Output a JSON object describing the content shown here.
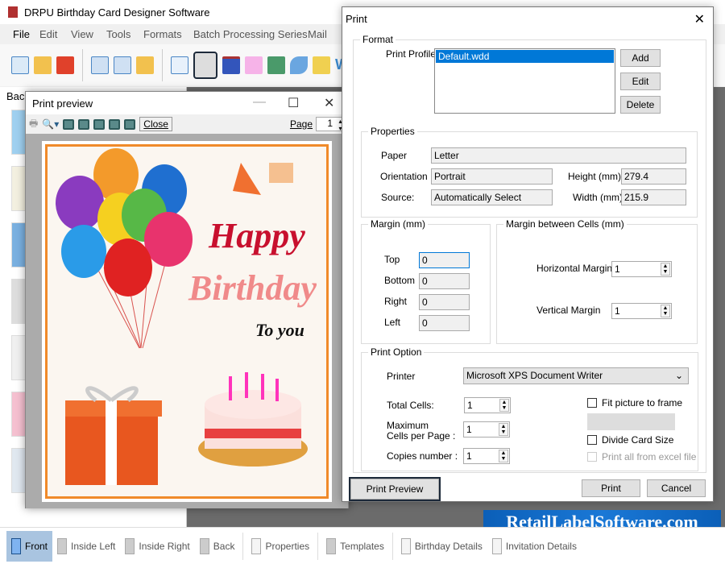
{
  "app": {
    "title": "DRPU Birthday Card Designer Software"
  },
  "menu": [
    "File",
    "Edit",
    "View",
    "Tools",
    "Formats",
    "Batch Processing Series",
    "Mail"
  ],
  "left_panel": {
    "label": "Bac"
  },
  "preview": {
    "title": "Print preview",
    "close_label": "Close",
    "page_label": "Page",
    "page_value": "1"
  },
  "card": {
    "line1": "Happy",
    "line2": "Birthday",
    "line3": "To you",
    "colors": {
      "happy": "#c8102e",
      "birthday": "#f08a8a",
      "border": "#f08a2a"
    }
  },
  "dialog": {
    "title": "Print",
    "format": {
      "legend": "Format",
      "print_profile_label": "Print Profile",
      "profiles": [
        "Default.wdd"
      ],
      "add": "Add",
      "edit": "Edit",
      "delete": "Delete"
    },
    "properties": {
      "legend": "Properties",
      "paper_label": "Paper",
      "paper": "Letter",
      "orientation_label": "Orientation",
      "orientation": "Portrait",
      "source_label": "Source:",
      "source": "Automatically Select",
      "height_label": "Height (mm)",
      "height": "279.4",
      "width_label": "Width (mm)",
      "width": "215.9"
    },
    "margin": {
      "legend": "Margin (mm)",
      "top_label": "Top",
      "top": "0",
      "bottom_label": "Bottom",
      "bottom": "0",
      "right_label": "Right",
      "right": "0",
      "left_label": "Left",
      "left": "0"
    },
    "cell_margin": {
      "legend": "Margin between Cells (mm)",
      "horizontal_label": "Horizontal Margin",
      "horizontal": "1",
      "vertical_label": "Vertical Margin",
      "vertical": "1"
    },
    "print_option": {
      "legend": "Print Option",
      "printer_label": "Printer",
      "printer": "Microsoft XPS Document Writer",
      "total_cells_label": "Total Cells:",
      "total_cells": "1",
      "max_cells_label1": "Maximum",
      "max_cells_label2": "Cells per Page :",
      "max_cells": "1",
      "copies_label": "Copies number :",
      "copies": "1",
      "fit_label": "Fit picture to frame",
      "fit_checked": false,
      "divide_label": "Divide Card Size",
      "divide_checked": false,
      "excel_label": "Print all from excel file",
      "excel_checked": false
    },
    "print_preview": "Print Preview",
    "print": "Print",
    "cancel": "Cancel"
  },
  "bottom_tabs": [
    "Front",
    "Inside Left",
    "Inside Right",
    "Back",
    "Properties",
    "Templates",
    "Birthday Details",
    "Invitation Details"
  ],
  "watermark": "RetailLabelSoftware.com"
}
